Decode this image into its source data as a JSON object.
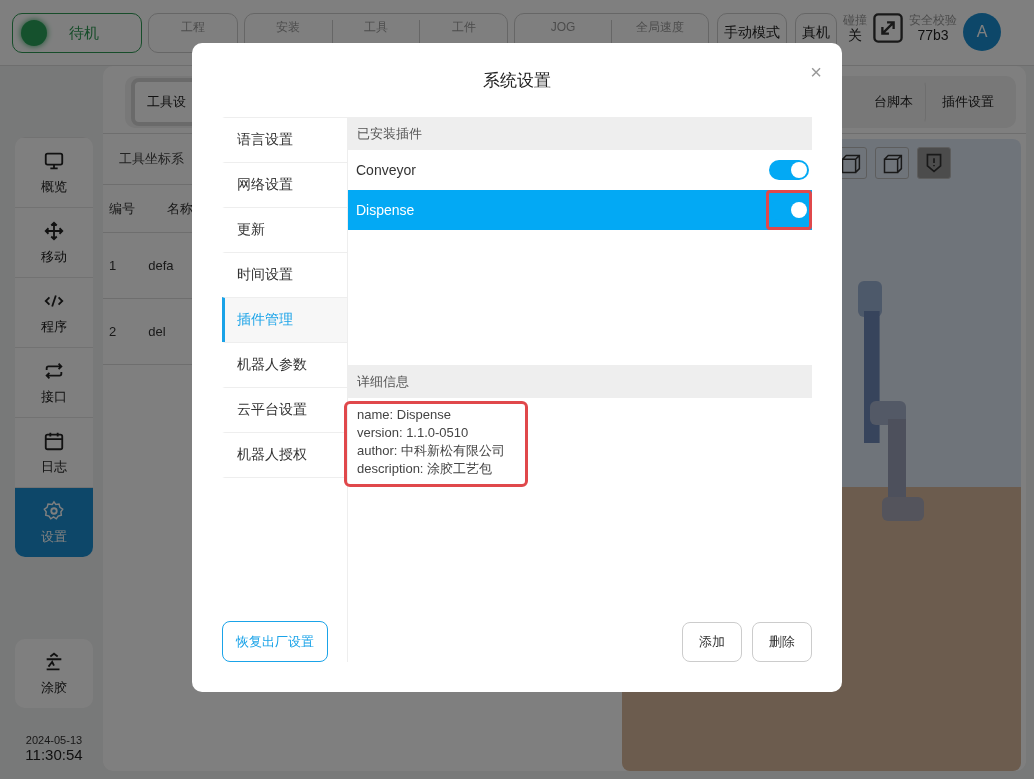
{
  "topbar": {
    "status": {
      "label": "待机",
      "running": false
    },
    "project": {
      "label": "工程"
    },
    "install_group": [
      {
        "label": "安装"
      },
      {
        "label": "工具"
      },
      {
        "label": "工件"
      }
    ],
    "jog_group": [
      {
        "label": "JOG"
      },
      {
        "label": "全局速度"
      }
    ],
    "buttons": [
      "手动模式",
      "真机"
    ],
    "collision": {
      "label": "碰撞",
      "value": "关"
    },
    "safety": {
      "label": "安全校验",
      "value": "77b3"
    },
    "avatar": "A"
  },
  "sidebar": {
    "items": [
      {
        "label": "概览",
        "selected": false
      },
      {
        "label": "移动",
        "selected": false
      },
      {
        "label": "程序",
        "selected": false
      },
      {
        "label": "接口",
        "selected": false
      },
      {
        "label": "日志",
        "selected": false
      },
      {
        "label": "设置",
        "selected": true
      }
    ],
    "plugin_button": "涂胶",
    "date": "2024-05-13",
    "time": "11:30:54"
  },
  "main": {
    "tabs": [
      {
        "label": "工具设",
        "selected": true
      },
      {
        "label": "台脚本",
        "selected": false
      },
      {
        "label": "插件设置",
        "selected": false
      }
    ],
    "subtab": "工具坐标系",
    "table": {
      "columns": [
        "编号",
        "名称"
      ],
      "rows": [
        [
          "1",
          "defa"
        ],
        [
          "2",
          "del"
        ]
      ]
    }
  },
  "dialog": {
    "title": "系统设置",
    "close": "×",
    "menu": [
      {
        "label": "语言设置",
        "selected": false
      },
      {
        "label": "网络设置",
        "selected": false
      },
      {
        "label": "更新",
        "selected": false
      },
      {
        "label": "时间设置",
        "selected": false
      },
      {
        "label": "插件管理",
        "selected": true
      },
      {
        "label": "机器人参数",
        "selected": false
      },
      {
        "label": "云平台设置",
        "selected": false
      },
      {
        "label": "机器人授权",
        "selected": false
      }
    ],
    "reset_button": "恢复出厂设置",
    "installed_header": "已安装插件",
    "plugins": [
      {
        "name": "Conveyor",
        "on": true,
        "selected": false,
        "highlighted": false
      },
      {
        "name": "Dispense",
        "on": true,
        "selected": true,
        "highlighted": true
      }
    ],
    "details_header": "详细信息",
    "details": {
      "lines": [
        "name: Dispense",
        "version: 1.1.0-0510",
        "author: 中科新松有限公司",
        "description: 涂胶工艺包"
      ],
      "highlighted": true
    },
    "buttons": [
      "添加",
      "删除"
    ]
  }
}
